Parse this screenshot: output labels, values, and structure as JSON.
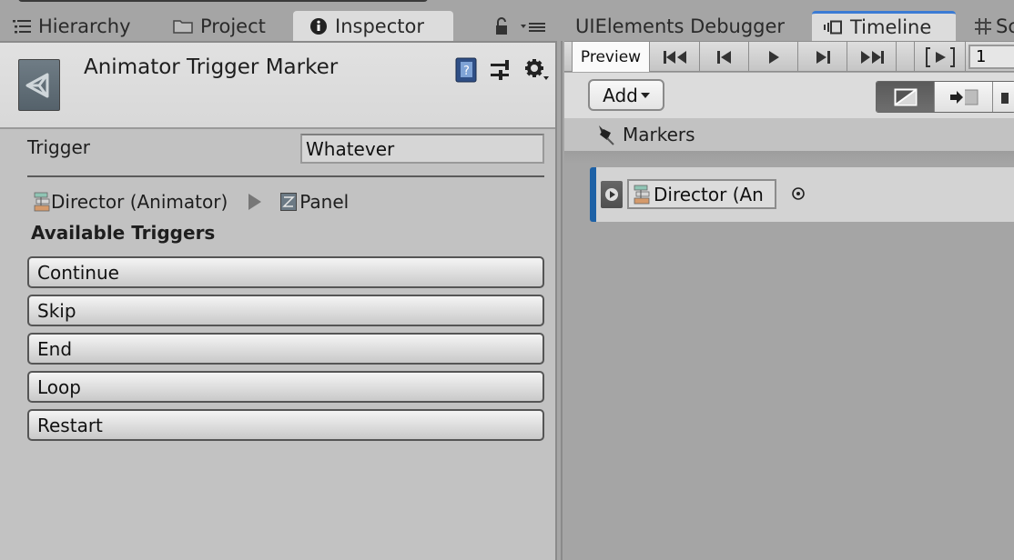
{
  "left_tabs": [
    {
      "label": "Hierarchy",
      "icon": "hierarchy-list-icon",
      "active": false
    },
    {
      "label": "Project",
      "icon": "folder-icon",
      "active": false
    },
    {
      "label": "Inspector",
      "icon": "info-icon",
      "active": true
    }
  ],
  "right_tabs": [
    {
      "label": "UIElements Debugger",
      "active": false
    },
    {
      "label": "Timeline",
      "icon": "timeline-icon",
      "active": true
    },
    {
      "label": "Sc",
      "icon": "grid-icon",
      "active": false
    }
  ],
  "inspector": {
    "title": "Animator Trigger Marker",
    "trigger_label": "Trigger",
    "trigger_value": "Whatever",
    "path_source": "Director (Animator)",
    "path_target": "Panel",
    "available_title": "Available Triggers",
    "triggers": [
      "Continue",
      "Skip",
      "End",
      "Loop",
      "Restart"
    ]
  },
  "timeline": {
    "preview_label": "Preview",
    "frame_value": "1",
    "add_label": "Add",
    "markers_label": "Markers",
    "track_binding": "Director (An",
    "accent_color": "#1d61a6"
  }
}
